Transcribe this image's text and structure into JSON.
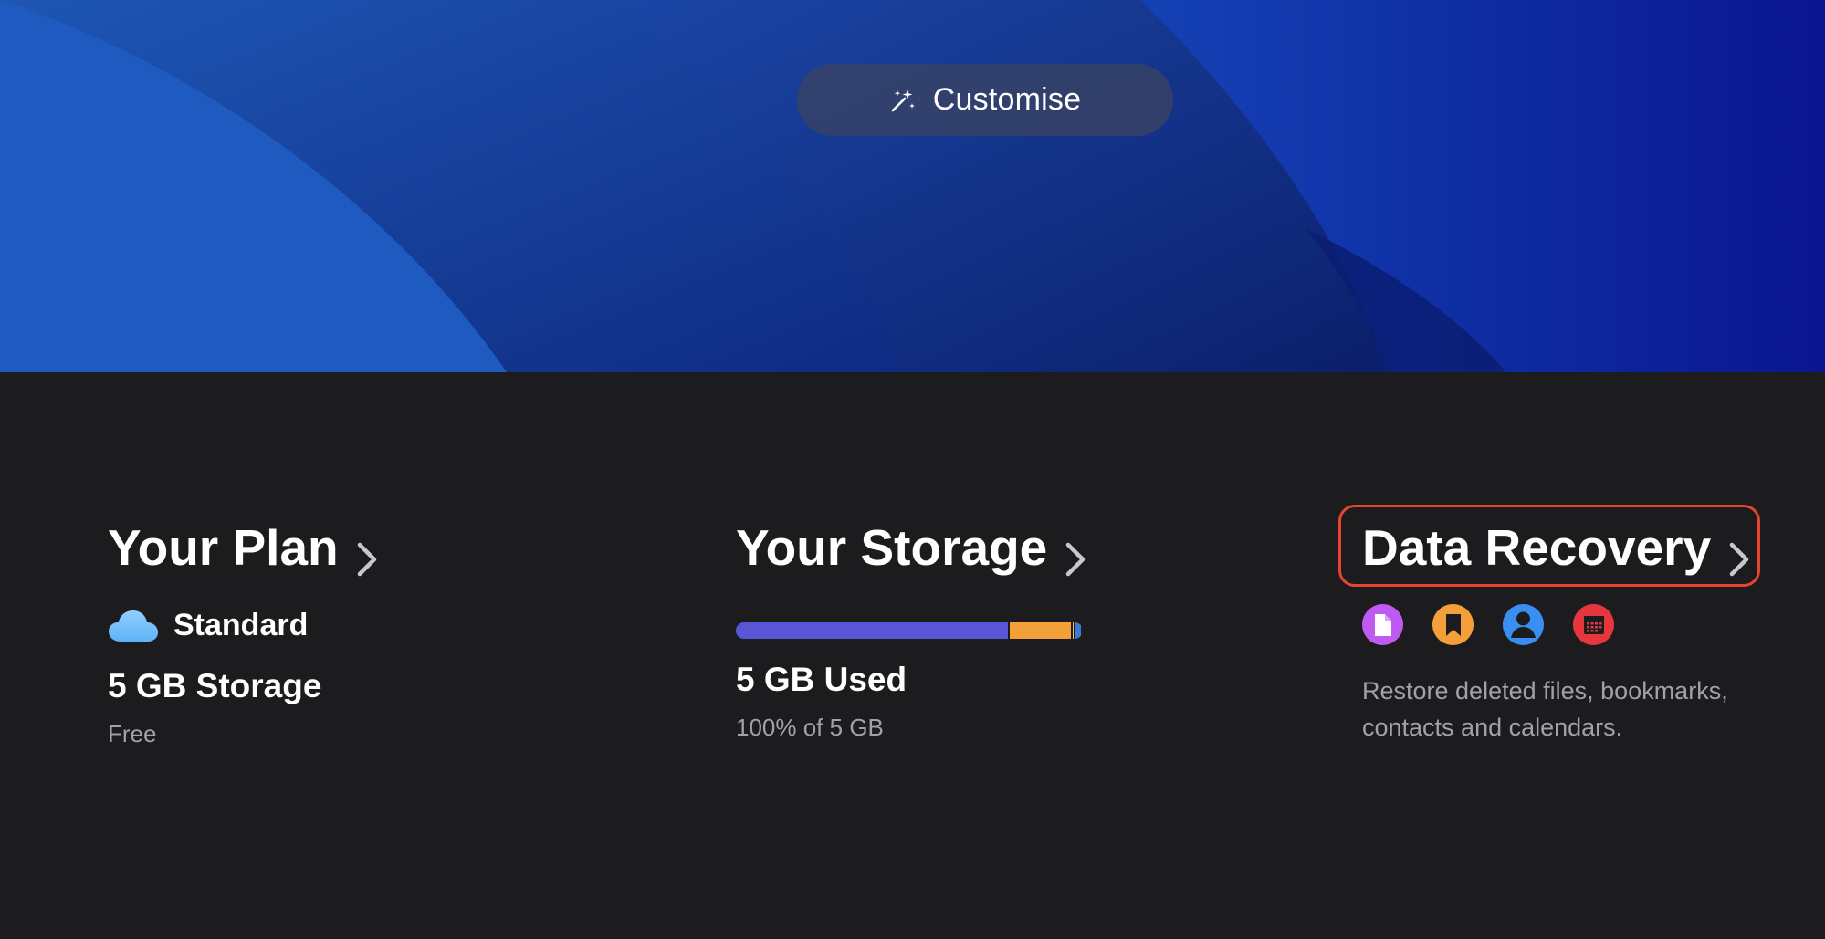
{
  "hero": {
    "customise_label": "Customise",
    "customise_icon": "magic-wand-icon"
  },
  "plan": {
    "heading": "Your Plan",
    "tier_icon": "cloud-icon",
    "tier_name": "Standard",
    "storage": "5 GB Storage",
    "price": "Free"
  },
  "storage": {
    "heading": "Your Storage",
    "used_label": "5 GB Used",
    "detail": "100% of 5 GB",
    "usage_fraction": 1.0,
    "segments": [
      {
        "name": "primary",
        "fraction": 0.79,
        "color": "#5856d6"
      },
      {
        "name": "secondary",
        "fraction": 0.18,
        "color": "#f3a03a"
      },
      {
        "name": "tertiary",
        "fraction": 0.008,
        "color": "#f5c542"
      },
      {
        "name": "other",
        "fraction": 0.022,
        "color": "#3a7bd5"
      }
    ]
  },
  "recovery": {
    "heading": "Data Recovery",
    "icons": [
      {
        "name": "document-icon",
        "color": "#bf5af2"
      },
      {
        "name": "bookmark-icon",
        "color": "#f3a03a"
      },
      {
        "name": "contact-icon",
        "color": "#3a8ef0"
      },
      {
        "name": "calendar-icon",
        "color": "#e5373d"
      }
    ],
    "description": "Restore deleted files, bookmarks, contacts and calendars."
  },
  "colors": {
    "background": "#1c1c1e",
    "highlight": "#e5452e",
    "secondary_text": "#a1a1a6"
  }
}
